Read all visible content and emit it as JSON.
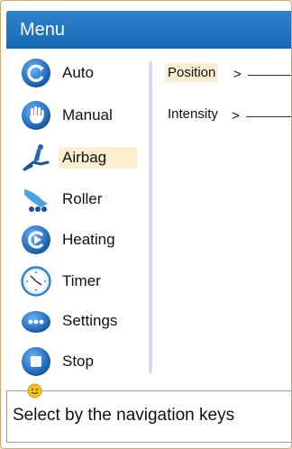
{
  "header": {
    "title": "Menu"
  },
  "menu": {
    "items": [
      {
        "label": "Auto",
        "icon": "auto-icon"
      },
      {
        "label": "Manual",
        "icon": "hand-icon"
      },
      {
        "label": "Airbag",
        "icon": "massage-chair-icon",
        "selected": true
      },
      {
        "label": "Roller",
        "icon": "roller-icon"
      },
      {
        "label": "Heating",
        "icon": "heating-icon"
      },
      {
        "label": "Timer",
        "icon": "clock-icon"
      },
      {
        "label": "Settings",
        "icon": "settings-icon"
      },
      {
        "label": "Stop",
        "icon": "stop-icon"
      }
    ]
  },
  "submenu": {
    "items": [
      {
        "label": "Position",
        "arrow": ">",
        "selected": true
      },
      {
        "label": "Intensity",
        "arrow": ">"
      }
    ]
  },
  "hint": {
    "text": "Select by the navigation keys",
    "icon": "smiley-icon"
  },
  "colors": {
    "title_bar": "#1e73be",
    "highlight": "#fbefcf",
    "frame_border": "#d6a569"
  }
}
